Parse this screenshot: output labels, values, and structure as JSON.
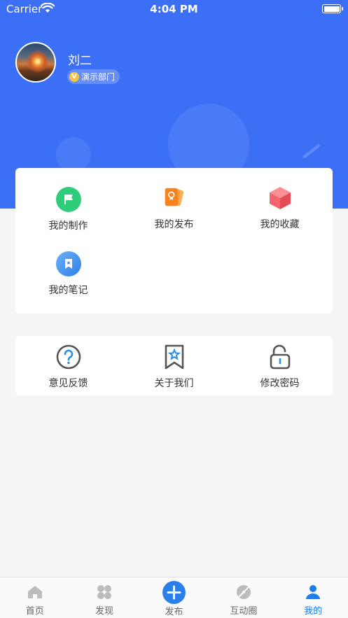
{
  "status_bar": {
    "carrier": "Carrier",
    "time": "4:04 PM"
  },
  "profile": {
    "name": "刘二",
    "department": "演示部门",
    "badge_letter": "V"
  },
  "features": [
    {
      "label": "我的制作",
      "icon": "flag-icon",
      "color": "#2fcd7a"
    },
    {
      "label": "我的发布",
      "icon": "cards-icon",
      "color": "#f7831d"
    },
    {
      "label": "我的收藏",
      "icon": "cube-icon",
      "color": "#f25f67"
    },
    {
      "label": "我的笔记",
      "icon": "bookmark-note-icon",
      "color": "#3a8ff0"
    }
  ],
  "settings": [
    {
      "label": "意见反馈",
      "icon": "question-icon"
    },
    {
      "label": "关于我们",
      "icon": "star-bookmark-icon"
    },
    {
      "label": "修改密码",
      "icon": "unlock-icon"
    }
  ],
  "tabs": [
    {
      "label": "首页",
      "icon": "home-icon"
    },
    {
      "label": "发现",
      "icon": "clover-icon"
    },
    {
      "label": "发布",
      "icon": "plus-icon"
    },
    {
      "label": "互动圈",
      "icon": "compass-slash-icon"
    },
    {
      "label": "我的",
      "icon": "person-icon",
      "active": true
    }
  ],
  "colors": {
    "header_blue": "#3b6ff5",
    "active_tab": "#1c7ee8",
    "page_bg": "#f5f5f5"
  }
}
